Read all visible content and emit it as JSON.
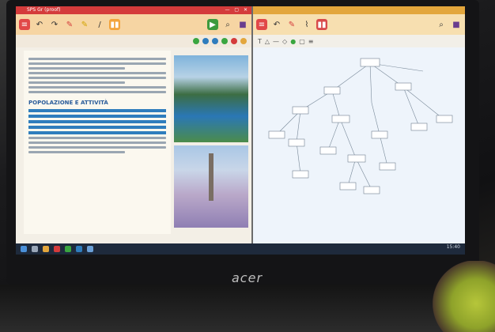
{
  "left_window": {
    "title": "SPS Gr (proof)",
    "window_controls": "— ▢ ✕",
    "toolbar_icons": [
      "menu-icon",
      "undo-icon",
      "redo-icon",
      "marker-red-icon",
      "marker-yellow-icon",
      "pen-icon",
      "book-icon",
      "play-icon",
      "search-icon",
      "shop-icon"
    ],
    "document": {
      "heading": "POPOLAZIONE E ATTIVITÀ"
    }
  },
  "right_window": {
    "title": "",
    "toolbar_icons": [
      "menu-icon",
      "undo-icon",
      "marker-icon",
      "brush-icon",
      "book-icon",
      "search-icon",
      "shop-icon"
    ]
  },
  "taskbar": {
    "time": "15:40"
  },
  "laptop_logo": "acer",
  "colors": {
    "left_title": "#d43b3b",
    "right_title": "#e3a63c",
    "highlight_blue": "#2f7dbd"
  }
}
